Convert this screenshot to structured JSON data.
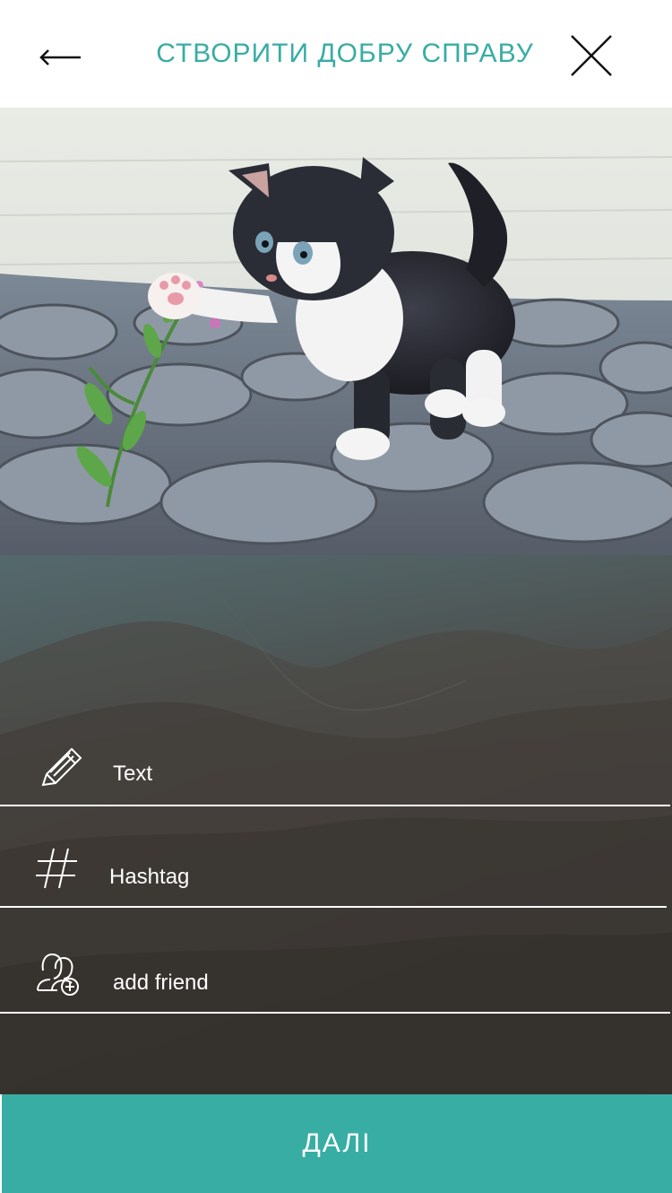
{
  "colors": {
    "accent": "#38ada4",
    "header_bg": "#ffffff",
    "field_line": "#ffffff",
    "button_bg": "#38ada4",
    "button_text": "#ffffff"
  },
  "header": {
    "title": "СТВОРИТИ ДОБРУ СПРАВУ",
    "back_icon": "arrow-left-icon",
    "close_icon": "close-icon"
  },
  "form": {
    "text_field": {
      "icon": "pencil-icon",
      "placeholder": "Text"
    },
    "hashtag_field": {
      "icon": "hashtag-icon",
      "placeholder": "Hashtag"
    },
    "friend_field": {
      "icon": "add-friend-icon",
      "placeholder": "add friend"
    }
  },
  "footer": {
    "next_label": "ДАЛІ"
  }
}
